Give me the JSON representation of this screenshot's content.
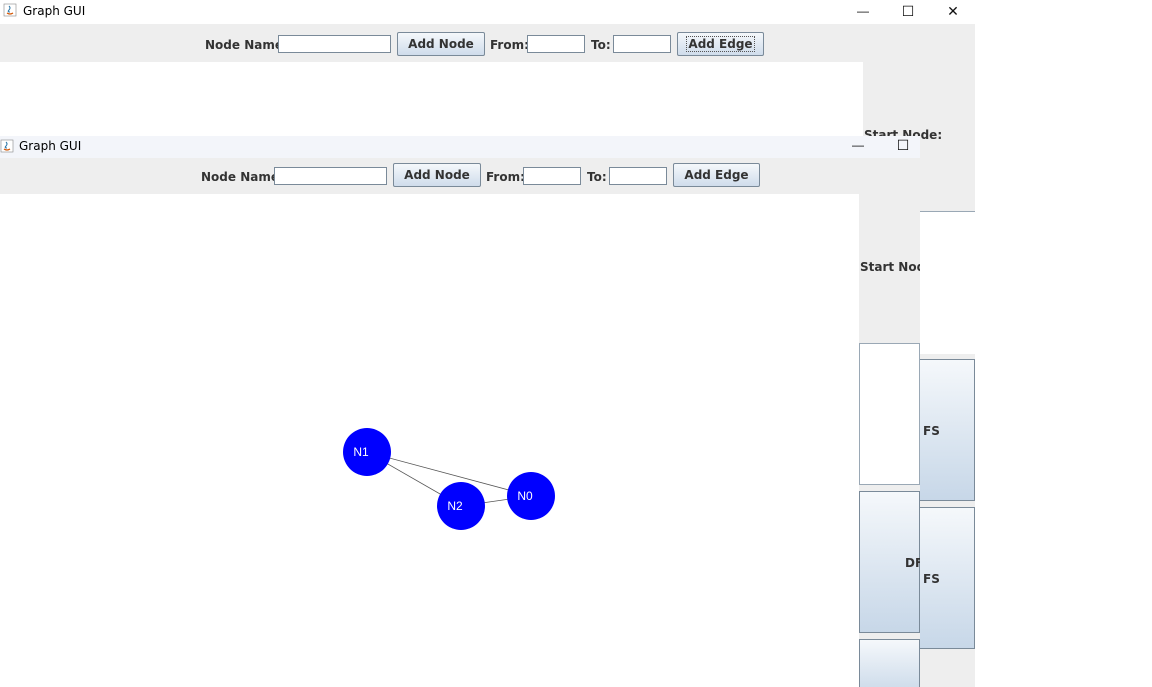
{
  "window_back": {
    "title": "Graph GUI",
    "node_name_label": "Node Name:",
    "add_node_label": "Add Node",
    "from_label": "From:",
    "to_label": "To:",
    "add_edge_label": "Add Edge",
    "start_node_label": "Start Node:",
    "bfs_partial": "FS",
    "dfs_partial": "FS",
    "minimize_glyph": "—",
    "maximize_glyph": "☐",
    "close_glyph": "✕"
  },
  "window_front": {
    "title": "Graph GUI",
    "node_name_label": "Node Name:",
    "add_node_label": "Add Node",
    "from_label": "From:",
    "to_label": "To:",
    "add_edge_label": "Add Edge",
    "start_node_label": "Start Node:",
    "dfs_partial": "DF",
    "minimize_glyph": "—",
    "maximize_glyph": "☐"
  },
  "graph": {
    "node_color": "#0000ff",
    "nodes": [
      "N1",
      "N2",
      "N0"
    ],
    "edges": [
      [
        "N1",
        "N0"
      ],
      [
        "N1",
        "N2"
      ],
      [
        "N2",
        "N0"
      ]
    ]
  },
  "colors": {
    "toolbar_bg": "#eeeeee",
    "button_gradient_top": "#f5f8fb",
    "button_gradient_bottom": "#c7d7e8"
  }
}
